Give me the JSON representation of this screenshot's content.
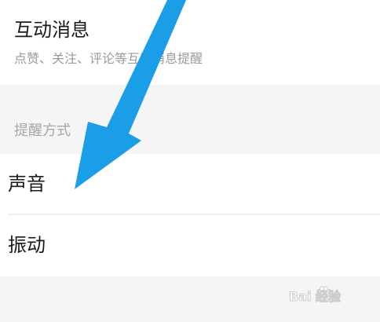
{
  "notification_item": {
    "title": "互动消息",
    "description": "点赞、关注、评论等互动消息提醒"
  },
  "reminder_section": {
    "header": "提醒方式",
    "options": [
      {
        "label": "声音"
      },
      {
        "label": "振动"
      }
    ]
  },
  "annotation": {
    "arrow_color": "#1a9ee8"
  },
  "watermark": {
    "text": "Bai 经验",
    "icon": "paw-icon"
  }
}
